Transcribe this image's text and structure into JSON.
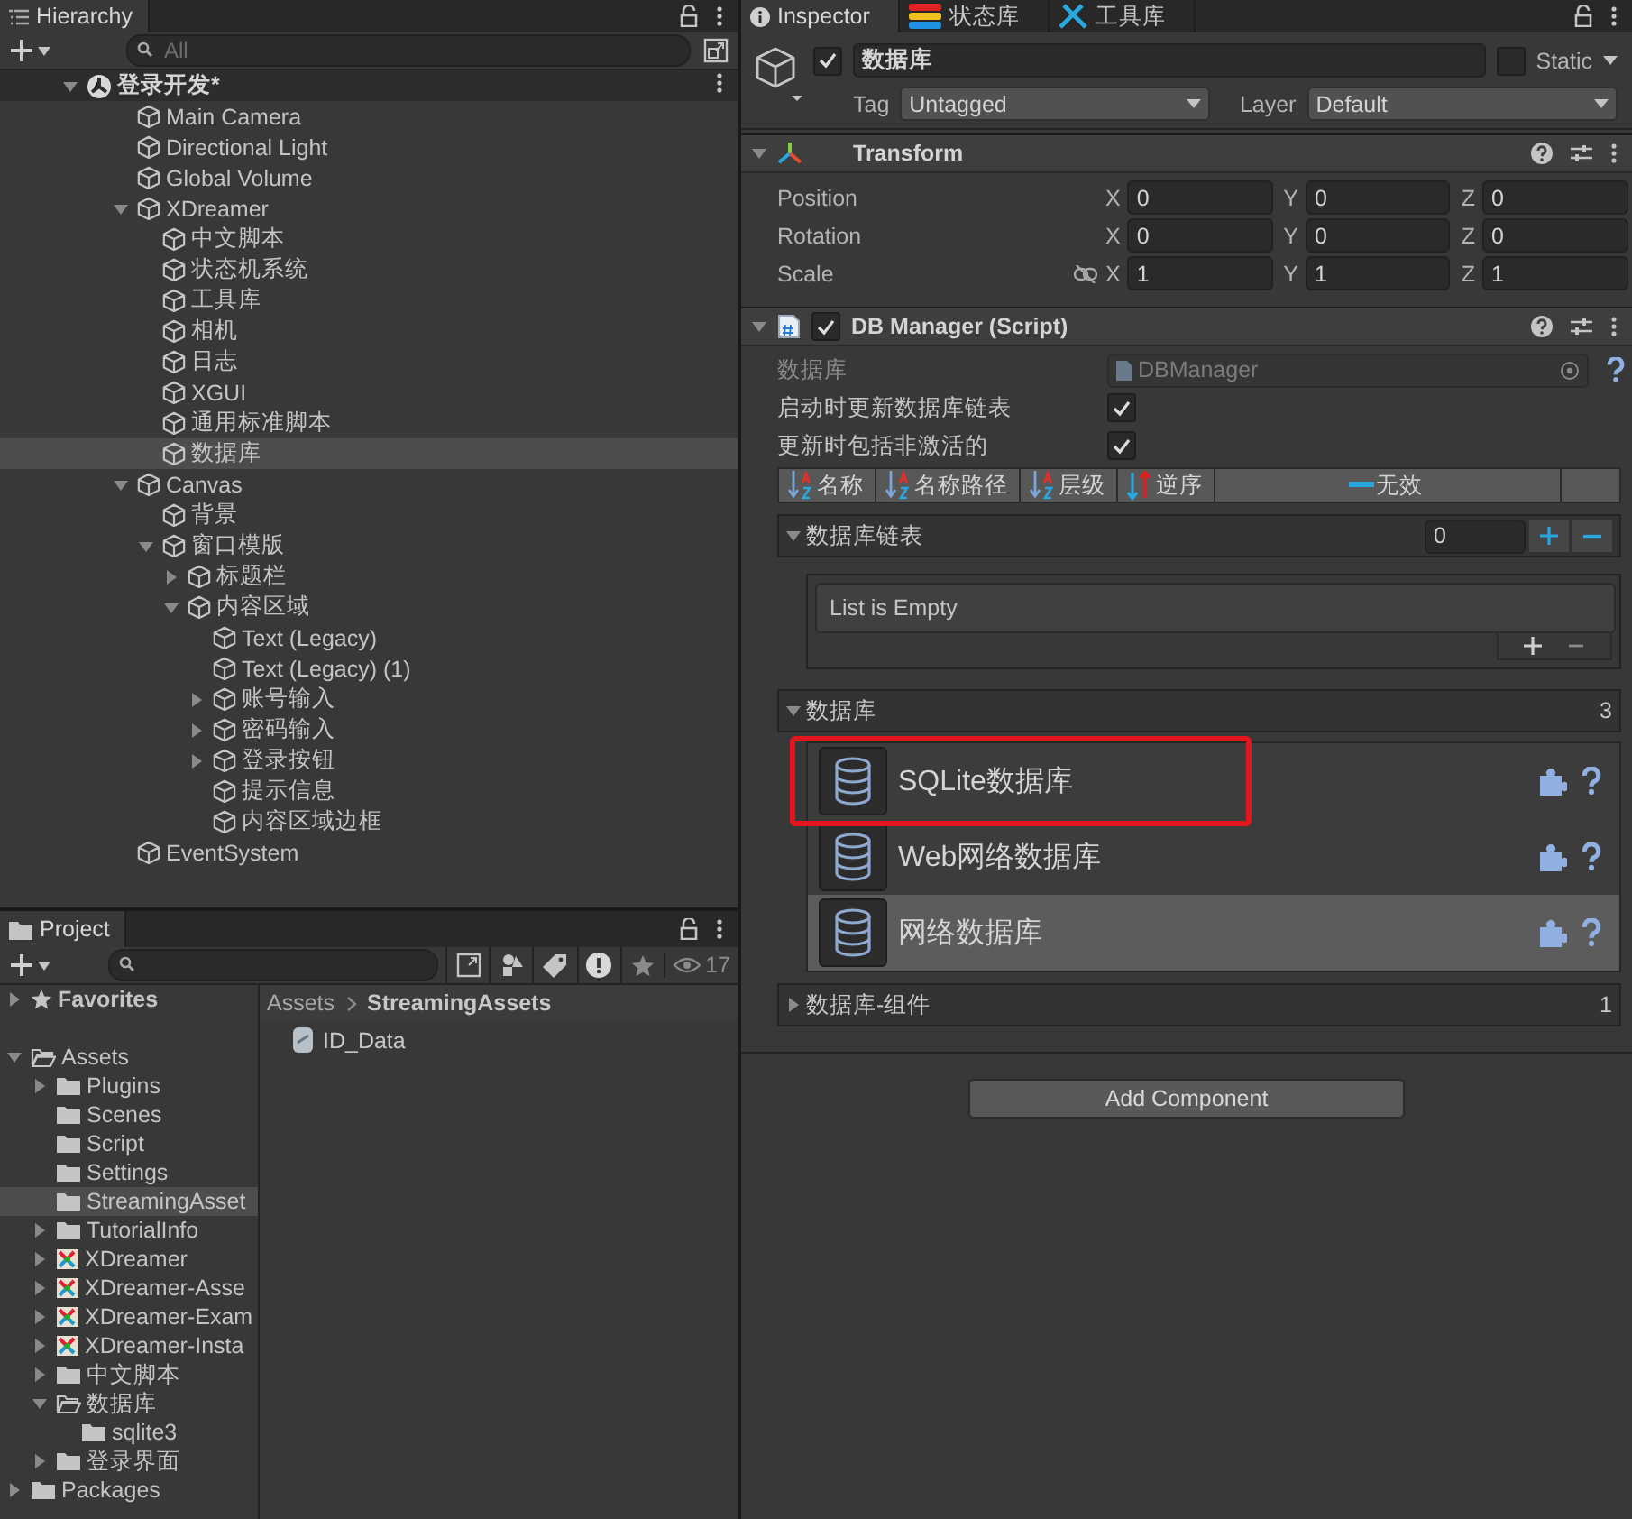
{
  "hierarchy": {
    "title": "Hierarchy",
    "search": {
      "placeholder": "All"
    },
    "scene": {
      "name": "登录开发*",
      "expanded": true,
      "children": [
        {
          "name": "Main Camera",
          "selected": false
        },
        {
          "name": "Directional Light",
          "selected": false
        },
        {
          "name": "Global Volume",
          "selected": false
        },
        {
          "name": "XDreamer",
          "selected": false,
          "expanded": true,
          "children": [
            {
              "name": "中文脚本",
              "selected": false
            },
            {
              "name": "状态机系统",
              "selected": false
            },
            {
              "name": "工具库",
              "selected": false
            },
            {
              "name": "相机",
              "selected": false
            },
            {
              "name": "日志",
              "selected": false
            },
            {
              "name": "XGUI",
              "selected": false
            },
            {
              "name": "通用标准脚本",
              "selected": false
            },
            {
              "name": "数据库",
              "selected": true
            }
          ]
        },
        {
          "name": "Canvas",
          "selected": false,
          "expanded": true,
          "children": [
            {
              "name": "背景",
              "selected": false
            },
            {
              "name": "窗口模版",
              "selected": false,
              "expanded": true,
              "children": [
                {
                  "name": "标题栏",
                  "selected": false,
                  "expanded": false
                },
                {
                  "name": "内容区域",
                  "selected": false,
                  "expanded": true,
                  "children": [
                    {
                      "name": "Text (Legacy)",
                      "selected": false
                    },
                    {
                      "name": "Text (Legacy) (1)",
                      "selected": false
                    },
                    {
                      "name": "账号输入",
                      "selected": false,
                      "expanded": false
                    },
                    {
                      "name": "密码输入",
                      "selected": false,
                      "expanded": false
                    },
                    {
                      "name": "登录按钮",
                      "selected": false,
                      "expanded": false
                    },
                    {
                      "name": "提示信息",
                      "selected": false
                    },
                    {
                      "name": "内容区域边框",
                      "selected": false
                    }
                  ]
                }
              ]
            }
          ]
        },
        {
          "name": "EventSystem",
          "selected": false
        }
      ]
    }
  },
  "project": {
    "title": "Project",
    "filter_count": "17",
    "tree": [
      {
        "name": "Favorites",
        "kind": "favorites",
        "selected": false,
        "expanded": false
      },
      {
        "name": "Assets",
        "kind": "folder",
        "selected": false,
        "expanded": true,
        "children": [
          {
            "name": "Plugins",
            "kind": "folder",
            "selected": false,
            "expanded": false
          },
          {
            "name": "Scenes",
            "kind": "folder",
            "selected": false
          },
          {
            "name": "Script",
            "kind": "folder",
            "selected": false
          },
          {
            "name": "Settings",
            "kind": "folder",
            "selected": false
          },
          {
            "name": "StreamingAsset",
            "kind": "folder",
            "selected": true
          },
          {
            "name": "TutorialInfo",
            "kind": "folder",
            "selected": false,
            "expanded": false
          },
          {
            "name": "XDreamer",
            "kind": "package",
            "selected": false,
            "expanded": false
          },
          {
            "name": "XDreamer-Asse",
            "kind": "package",
            "selected": false,
            "expanded": false
          },
          {
            "name": "XDreamer-Exam",
            "kind": "package",
            "selected": false,
            "expanded": false
          },
          {
            "name": "XDreamer-Insta",
            "kind": "package",
            "selected": false,
            "expanded": false
          },
          {
            "name": "中文脚本",
            "kind": "folder",
            "selected": false,
            "expanded": false
          },
          {
            "name": "数据库",
            "kind": "folder",
            "selected": false,
            "expanded": true,
            "children": [
              {
                "name": "sqlite3",
                "kind": "folder",
                "selected": false
              }
            ]
          },
          {
            "name": "登录界面",
            "kind": "folder",
            "selected": false,
            "expanded": false
          }
        ]
      },
      {
        "name": "Packages",
        "kind": "folder",
        "selected": false,
        "expanded": false
      }
    ],
    "breadcrumb": [
      "Assets",
      "StreamingAssets"
    ],
    "files": [
      {
        "name": "ID_Data"
      }
    ]
  },
  "inspector": {
    "tabs": [
      {
        "label": "Inspector",
        "kind": "info",
        "selected": true
      },
      {
        "label": "状态库",
        "kind": "stack",
        "selected": false
      },
      {
        "label": "工具库",
        "kind": "tools",
        "selected": false
      }
    ],
    "object": {
      "active": true,
      "name": "数据库",
      "static": false,
      "static_label": "Static",
      "tag_label": "Tag",
      "tag": "Untagged",
      "layer_label": "Layer",
      "layer": "Default"
    },
    "transform": {
      "title": "Transform",
      "expanded": true,
      "rows": [
        {
          "label": "Position",
          "kind": "vector",
          "fields": [
            {
              "axis": "X",
              "value": "0"
            },
            {
              "axis": "Y",
              "value": "0"
            },
            {
              "axis": "Z",
              "value": "0"
            }
          ]
        },
        {
          "label": "Rotation",
          "kind": "vector",
          "fields": [
            {
              "axis": "X",
              "value": "0"
            },
            {
              "axis": "Y",
              "value": "0"
            },
            {
              "axis": "Z",
              "value": "0"
            }
          ]
        },
        {
          "label": "Scale",
          "kind": "scale",
          "fields": [
            {
              "axis": "X",
              "value": "1"
            },
            {
              "axis": "Y",
              "value": "1"
            },
            {
              "axis": "Z",
              "value": "1"
            }
          ]
        }
      ]
    },
    "db_manager": {
      "title": "DB Manager (Script)",
      "enabled": true,
      "expanded": true,
      "script_label": "数据库",
      "script": "DBManager",
      "toggles": [
        {
          "label": "启动时更新数据库链表",
          "checked": true
        },
        {
          "label": "更新时包括非激活的",
          "checked": true
        }
      ],
      "sort_buttons": [
        {
          "label": "名称",
          "kind": "az"
        },
        {
          "label": "名称路径",
          "kind": "az"
        },
        {
          "label": "层级",
          "kind": "az"
        },
        {
          "label": "逆序",
          "kind": "reverse"
        },
        {
          "label": "无效",
          "kind": "none"
        }
      ],
      "list": {
        "title": "数据库链表",
        "expanded": true,
        "count": "0",
        "empty_text": "List is Empty"
      },
      "databases": {
        "title": "数据库",
        "expanded": true,
        "count": "3",
        "items": [
          {
            "name": "SQLite数据库",
            "selected": false,
            "highlighted": true
          },
          {
            "name": "Web网络数据库",
            "selected": false,
            "highlighted": false
          },
          {
            "name": "网络数据库",
            "selected": true,
            "highlighted": false
          }
        ]
      },
      "components": {
        "title": "数据库-组件",
        "expanded": false,
        "count": "1"
      }
    },
    "add_component": "Add Component"
  }
}
